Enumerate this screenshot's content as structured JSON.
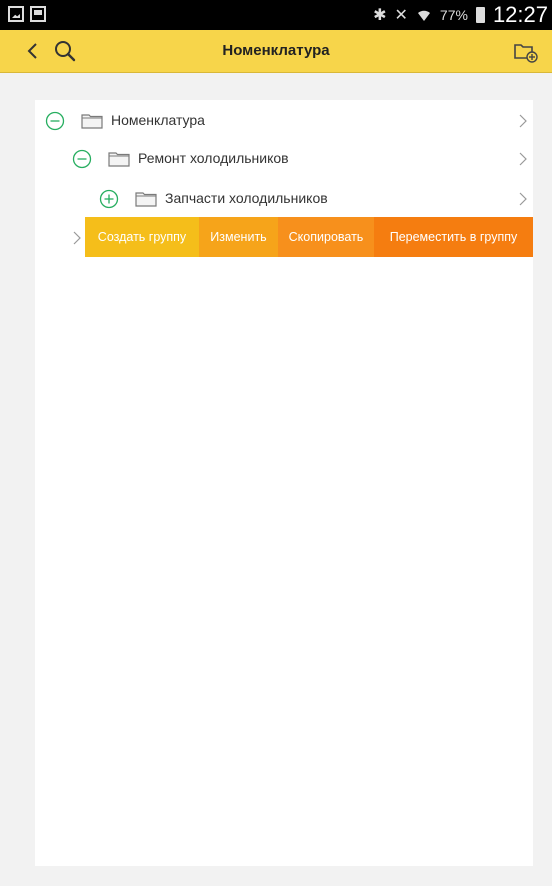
{
  "status_bar": {
    "battery": "77%",
    "time": "12:27",
    "icons": [
      "gallery-icon",
      "screen-icon",
      "bluetooth-icon",
      "mute-icon",
      "wifi-icon",
      "battery-icon"
    ]
  },
  "app_bar": {
    "title": "Номенклатура",
    "icons": [
      "back-icon",
      "search-icon",
      "add-folder-icon"
    ],
    "accent": "#f7d54a"
  },
  "tree": {
    "items": [
      {
        "label": "Номенклатура",
        "state": "expanded"
      },
      {
        "label": "Ремонт холодильников",
        "state": "expanded"
      },
      {
        "label": "Запчасти холодильников",
        "state": "collapsed"
      }
    ],
    "toggle_color": "#27ae60"
  },
  "actions": {
    "create_group": "Создать группу",
    "edit": "Изменить",
    "copy": "Скопировать",
    "move_to_group": "Переместить в группу"
  }
}
